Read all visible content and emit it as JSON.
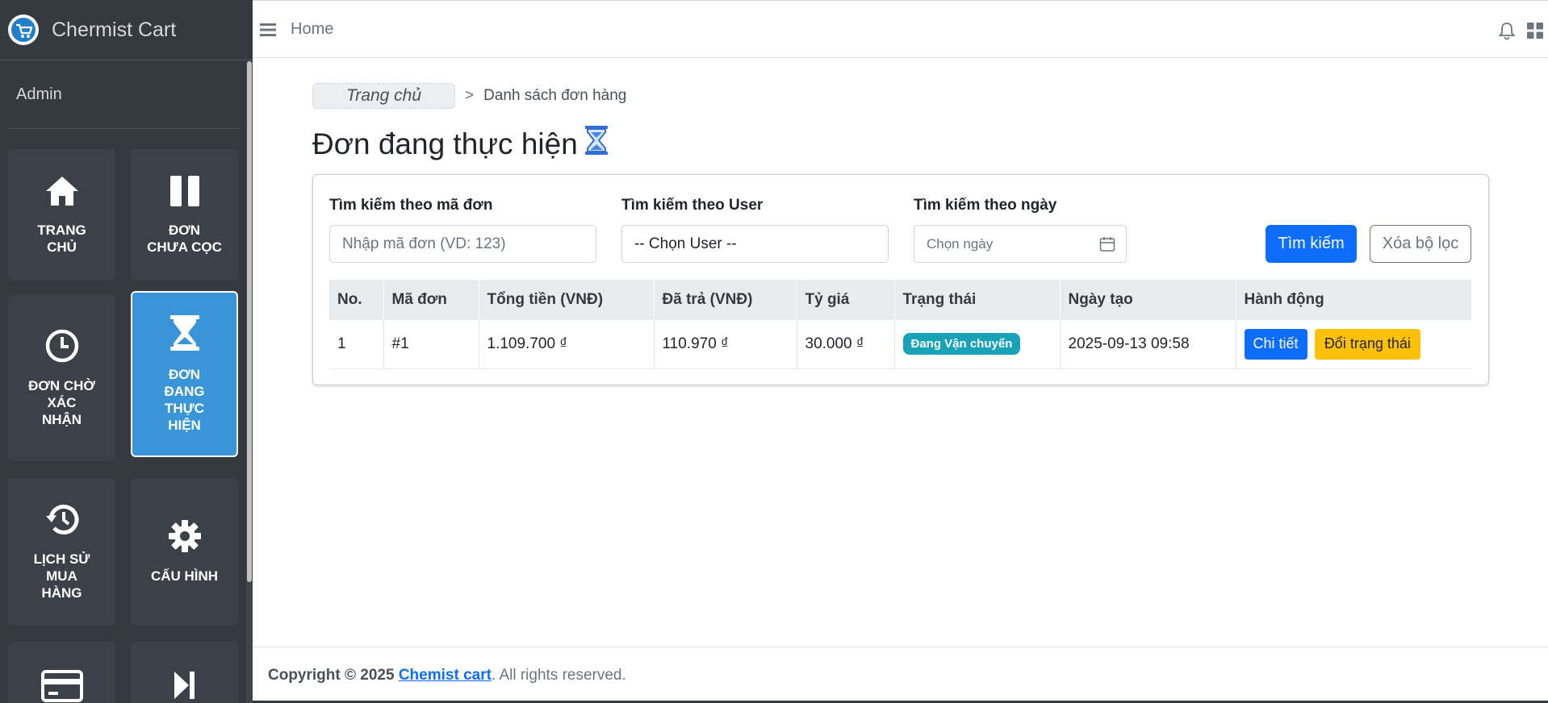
{
  "brand": {
    "name": "Chermist Cart"
  },
  "user": {
    "name": "Admin"
  },
  "sidebar": {
    "tiles": [
      {
        "label": "TRANG\nCHỦ",
        "icon": "home-icon"
      },
      {
        "label": "ĐƠN\nCHƯA CỌC",
        "icon": "pause-icon"
      },
      {
        "label": "ĐƠN CHỜ\nXÁC\nNHẬN",
        "icon": "clock-icon"
      },
      {
        "label": "ĐƠN\nĐANG\nTHỰC\nHIỆN",
        "icon": "hourglass-icon",
        "active": true
      },
      {
        "label": "LỊCH SỬ\nMUA\nHÀNG",
        "icon": "history-icon"
      },
      {
        "label": "CẤU HÌNH",
        "icon": "gear-icon"
      },
      {
        "label": "",
        "icon": "credit-card-icon"
      },
      {
        "label": "",
        "icon": "skip-forward-icon"
      }
    ]
  },
  "navbar": {
    "home": "Home"
  },
  "breadcrumb": {
    "home": "Trang chủ",
    "separator": ">",
    "current": "Danh sách đơn hàng"
  },
  "page": {
    "title": "Đơn đang thực hiện"
  },
  "filters": {
    "order_label": "Tìm kiếm theo mã đơn",
    "order_placeholder": "Nhập mã đơn (VD: 123)",
    "user_label": "Tìm kiếm theo User",
    "user_selected": "-- Chọn User --",
    "date_label": "Tìm kiếm theo ngày",
    "date_placeholder": "Chọn ngày",
    "search_button": "Tìm kiếm",
    "clear_button": "Xóa bộ lọc"
  },
  "table": {
    "headers": [
      "No.",
      "Mã đơn",
      "Tổng tiền (VNĐ)",
      "Đã trả (VNĐ)",
      "Tỷ giá",
      "Trạng thái",
      "Ngày tạo",
      "Hành động"
    ],
    "rows": [
      {
        "no": "1",
        "code": "#1",
        "total": "1.109.700 ₫",
        "paid": "110.970 ₫",
        "rate": "30.000 ₫",
        "status": "Đang Vận chuyển",
        "created": "2025-09-13 09:58",
        "detail_button": "Chi tiết",
        "status_button": "Đổi trạng thái"
      }
    ]
  },
  "footer": {
    "prefix": "Copyright © 2025",
    "link": "Chemist cart",
    "suffix": ". All rights reserved."
  },
  "colors": {
    "primary": "#0d6efd",
    "warning": "#ffc107",
    "info": "#17a2b8",
    "sidebar": "#343a40",
    "active_tile": "#3a95d8"
  }
}
